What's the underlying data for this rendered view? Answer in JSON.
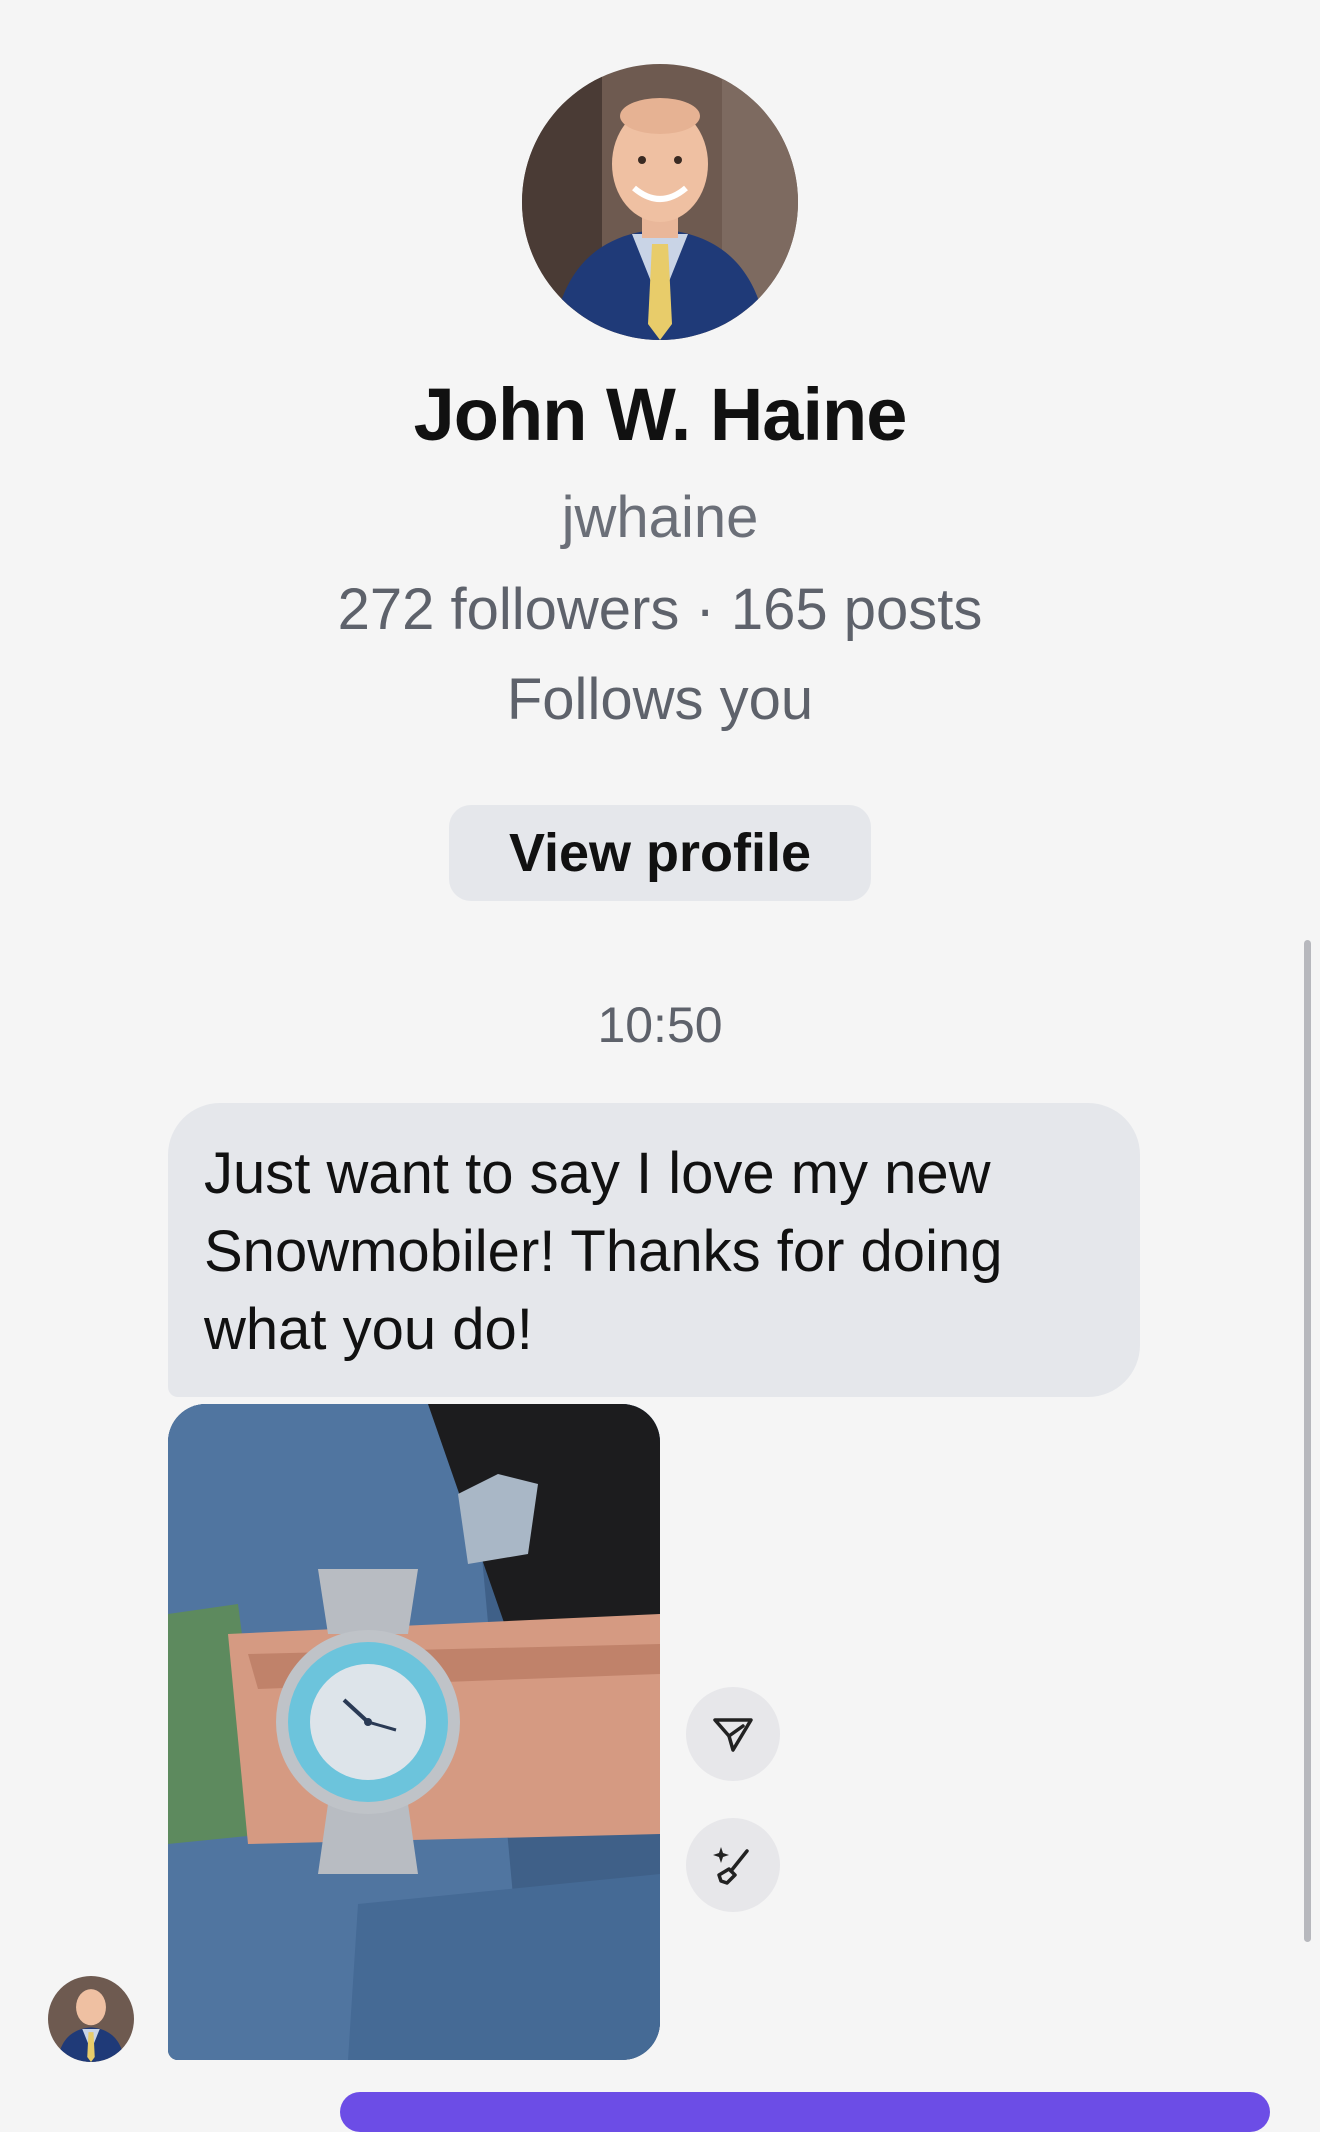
{
  "profile": {
    "name": "John W. Haine",
    "handle": "jwhaine",
    "stats": "272 followers · 165 posts",
    "relationship": "Follows you",
    "view_profile_label": "View profile"
  },
  "conversation": {
    "timestamp": "10:50",
    "message_text": "Just want to say I love my new Snowmobiler! Thanks for doing what you do!",
    "attachment": "photo of a wristwatch with a light blue bezel worn on a wrist"
  },
  "actions": {
    "share_icon": "send-icon",
    "edit_icon": "magic-brush-icon"
  },
  "colors": {
    "background": "#f5f5f5",
    "bubble": "#e5e7eb",
    "secondary_text": "#5e626b",
    "accent": "#6c4de6"
  }
}
